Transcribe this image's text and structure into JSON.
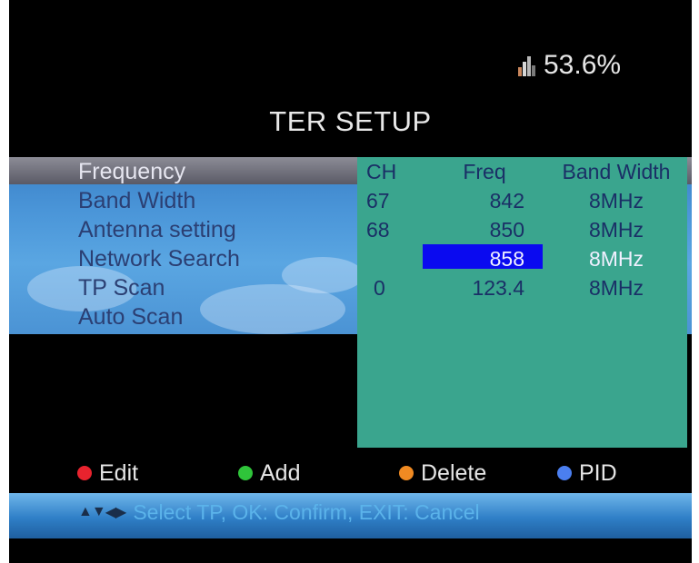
{
  "status": {
    "signal_text": "53.6%"
  },
  "title": "TER SETUP",
  "menu": {
    "items": [
      {
        "label": "Frequency"
      },
      {
        "label": "Band Width"
      },
      {
        "label": "Antenna setting"
      },
      {
        "label": "Network Search"
      },
      {
        "label": "TP Scan"
      },
      {
        "label": "Auto Scan"
      }
    ]
  },
  "table": {
    "headers": {
      "ch": "CH",
      "freq": "Freq",
      "bw": "Band Width"
    },
    "rows": [
      {
        "ch": "67",
        "freq": "842",
        "bw": "8MHz"
      },
      {
        "ch": "68",
        "freq": "850",
        "bw": "8MHz"
      },
      {
        "ch": "",
        "freq": "858",
        "bw": "8MHz"
      },
      {
        "ch": "0",
        "freq": "123.4",
        "bw": "8MHz"
      }
    ],
    "selected_row": 2
  },
  "legend": {
    "edit": "Edit",
    "add": "Add",
    "delete": "Delete",
    "pid": "PID"
  },
  "colors": {
    "edit": "#e8232e",
    "add": "#2fc43a",
    "delete": "#f08a22",
    "pid": "#4b7ff0"
  },
  "hint": {
    "icons": [
      "arrow-up-icon",
      "arrow-down-icon",
      "arrow-left-icon",
      "arrow-right-icon"
    ],
    "text": "Select TP, OK: Confirm, EXIT: Cancel"
  }
}
